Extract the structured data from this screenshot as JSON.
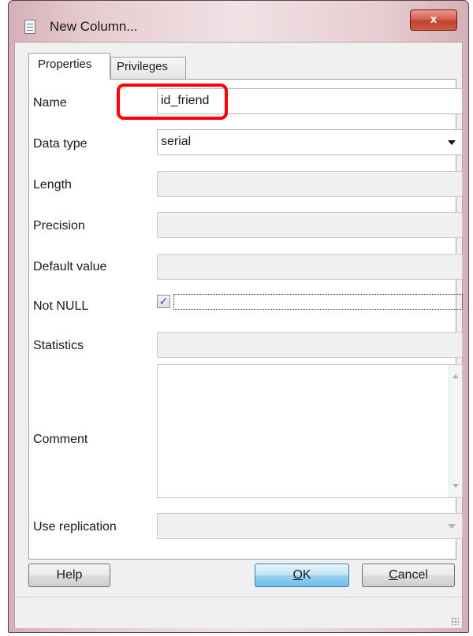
{
  "window": {
    "title": "New Column...",
    "close_label": "x"
  },
  "tabs": [
    {
      "label": "Properties",
      "active": true
    },
    {
      "label": "Privileges",
      "active": false
    }
  ],
  "form": {
    "name": {
      "label": "Name",
      "value": "id_friend"
    },
    "data_type": {
      "label": "Data type",
      "value": "serial"
    },
    "length": {
      "label": "Length",
      "value": ""
    },
    "precision": {
      "label": "Precision",
      "value": ""
    },
    "default_value": {
      "label": "Default value",
      "value": ""
    },
    "not_null": {
      "label": "Not NULL",
      "checked": true,
      "check_glyph": "✓"
    },
    "statistics": {
      "label": "Statistics",
      "value": ""
    },
    "comment": {
      "label": "Comment",
      "value": ""
    },
    "use_replication": {
      "label": "Use replication",
      "value": ""
    }
  },
  "buttons": {
    "help": "Help",
    "ok_mnemonic": "O",
    "ok_rest": "K",
    "cancel_mnemonic": "C",
    "cancel_rest": "ancel"
  },
  "annotation": {
    "highlight_color": "#ff0000"
  },
  "colors": {
    "close_button": "#c2412c",
    "ok_button": "#98d1ef"
  }
}
